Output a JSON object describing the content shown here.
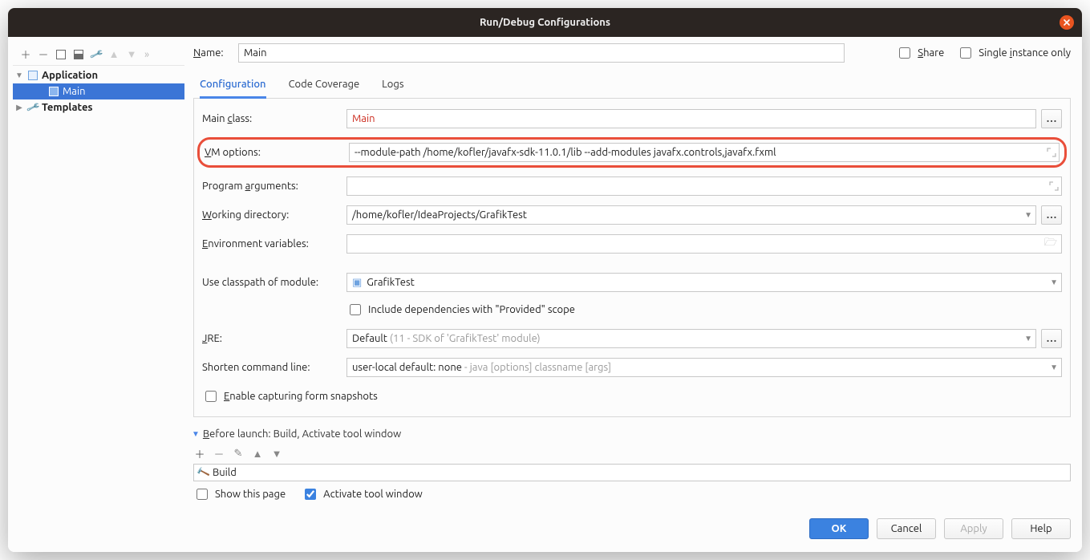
{
  "title": "Run/Debug Configurations",
  "nameRow": {
    "label": "Name:",
    "value": "Main",
    "share": "Share",
    "single": "Single instance only"
  },
  "tree": {
    "app": "Application",
    "appItem": "Main",
    "templates": "Templates"
  },
  "tabs": {
    "config": "Configuration",
    "coverage": "Code Coverage",
    "logs": "Logs"
  },
  "form": {
    "mainClassLabel": "Main class:",
    "mainClassValue": "Main",
    "vmLabel": "VM options:",
    "vmValue": "--module-path /home/kofler/javafx-sdk-11.0.1/lib --add-modules javafx.controls,javafx.fxml",
    "progArgsLabel": "Program arguments:",
    "progArgsValue": "",
    "workDirLabel": "Working directory:",
    "workDirValue": "/home/kofler/IdeaProjects/GrafikTest",
    "envLabel": "Environment variables:",
    "envValue": "",
    "classpathLabel": "Use classpath of module:",
    "classpathValue": "GrafikTest",
    "includeProvided": "Include dependencies with \"Provided\" scope",
    "jreLabel": "JRE:",
    "jrePrefix": "Default ",
    "jreSuffix": "(11 - SDK of 'GrafikTest' module)",
    "shortenLabel": "Shorten command line:",
    "shortenPrefix": "user-local default: none ",
    "shortenSuffix": "- java [options] classname [args]",
    "enableSnapshots": "Enable capturing form snapshots"
  },
  "beforeLaunch": {
    "header": "Before launch: Build, Activate tool window",
    "buildItem": "Build",
    "showThisPage": "Show this page",
    "activateTool": "Activate tool window"
  },
  "buttons": {
    "ok": "OK",
    "cancel": "Cancel",
    "apply": "Apply",
    "help": "Help"
  }
}
